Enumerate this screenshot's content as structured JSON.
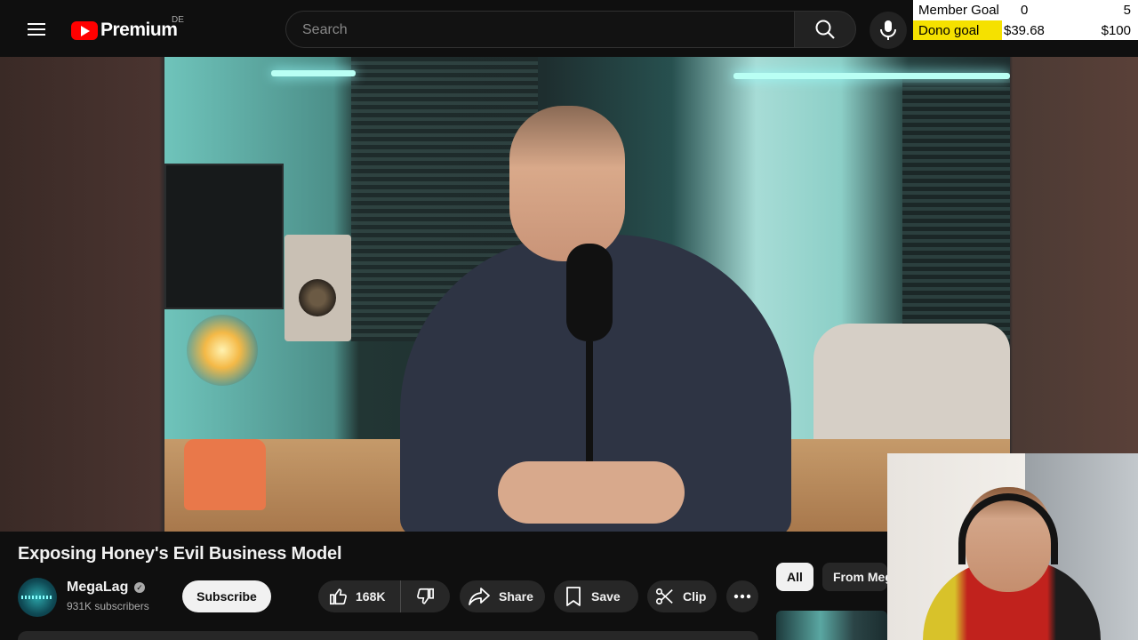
{
  "header": {
    "brand": "Premium",
    "country_code": "DE",
    "search": {
      "placeholder": "Search",
      "value": ""
    }
  },
  "goals": {
    "member_label": "Member Goal",
    "member_current": "0",
    "member_target": "5",
    "dono_label": "Dono goal",
    "dono_current": "$39.68",
    "dono_target": "$100"
  },
  "video": {
    "title": "Exposing Honey's Evil Business Model"
  },
  "channel": {
    "name": "MegaLag",
    "subscribers": "931K subscribers",
    "subscribe_label": "Subscribe"
  },
  "actions": {
    "like_count": "168K",
    "share_label": "Share",
    "save_label": "Save",
    "clip_label": "Clip"
  },
  "sidebar_chips": [
    "All",
    "From MegaLag"
  ],
  "colors": {
    "background": "#0f0f0f",
    "brand_red": "#ff0000",
    "pill_bg": "#272727",
    "dono_highlight": "#f5e100"
  }
}
